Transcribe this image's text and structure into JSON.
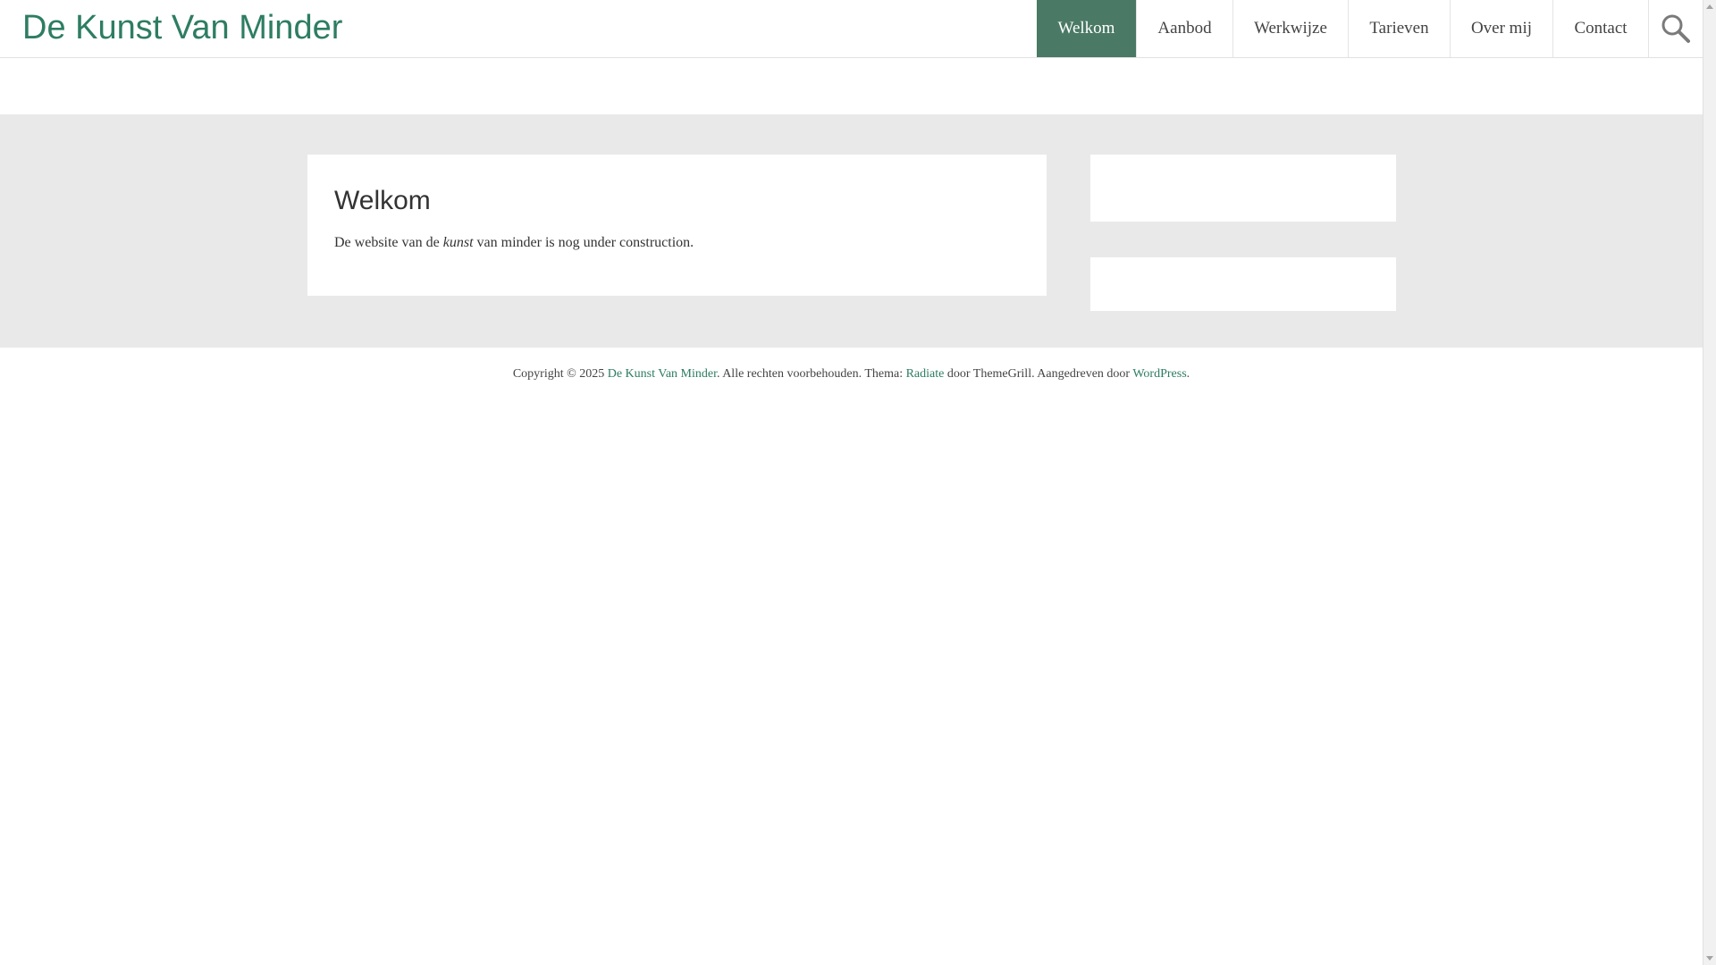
{
  "site": {
    "title": "De Kunst Van Minder"
  },
  "nav": {
    "items": [
      {
        "label": "Welkom",
        "active": true
      },
      {
        "label": "Aanbod"
      },
      {
        "label": "Werkwijze"
      },
      {
        "label": "Tarieven"
      },
      {
        "label": "Over mij"
      },
      {
        "label": "Contact"
      }
    ],
    "search_icon": "search-icon"
  },
  "main": {
    "title": "Welkom",
    "text_before": "De website van de ",
    "text_em": "kunst",
    "text_after": " van minder is nog under construction."
  },
  "footer": {
    "prefix": "Copyright © 2025 ",
    "site_link": "De Kunst Van Minder",
    "middle": ". Alle rechten voorbehouden. Thema: ",
    "theme_link": "Radiate",
    "by": " door ThemeGrill. Aangedreven door ",
    "wp_link": "WordPress",
    "suffix": "."
  },
  "colors": {
    "accent": "#2e7d62",
    "nav_active_bg": "#4a7965",
    "band_bg": "#e9e9e9"
  }
}
